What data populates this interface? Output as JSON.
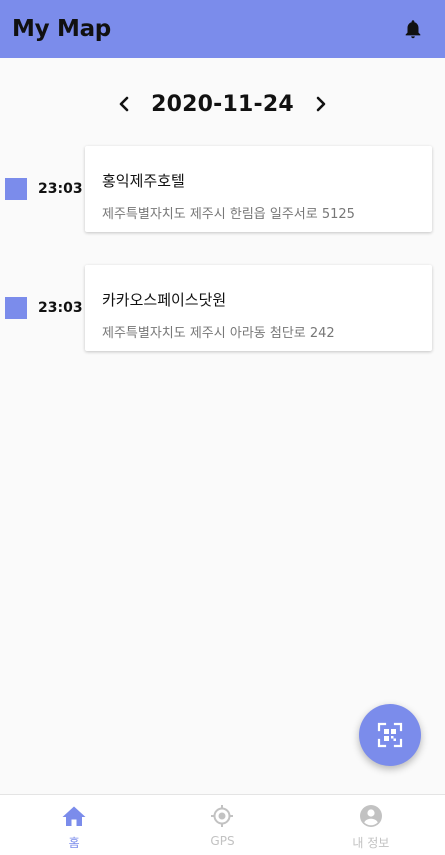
{
  "app_bar": {
    "title": "My Map",
    "background_color": "#7b8ceb",
    "notification_icon": "bell-icon"
  },
  "date_nav": {
    "date": "2020-11-24",
    "prev_icon": "chevron-left-icon",
    "next_icon": "chevron-right-icon"
  },
  "entries": [
    {
      "time": "23:03",
      "name": "홍익제주호텔",
      "address": "제주특별자치도 제주시 한림읍 일주서로 5125"
    },
    {
      "time": "23:03",
      "name": "카카오스페이스닷원",
      "address": "제주특별자치도 제주시 아라동 첨단로 242"
    }
  ],
  "fab": {
    "icon": "qr-scan-icon",
    "color": "#7b8ceb"
  },
  "bottom_nav": {
    "active": "홈",
    "tabs": [
      {
        "label": "홈",
        "icon": "home-icon"
      },
      {
        "label": "GPS",
        "icon": "gps-icon"
      },
      {
        "label": "내 정보",
        "icon": "account-icon"
      }
    ],
    "active_color": "#7b8ceb",
    "inactive_color": "#c2c2c2"
  }
}
